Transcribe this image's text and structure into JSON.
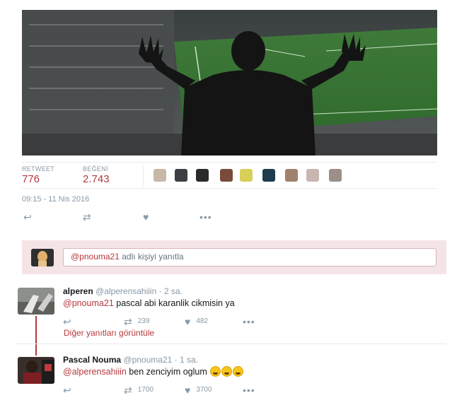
{
  "stats": {
    "retweet_label": "RETWEET",
    "retweet_count": "776",
    "like_label": "BEĞENİ",
    "like_count": "2.743"
  },
  "liker_avatars": [
    "#c9b8a8",
    "#3b3f44",
    "#2a2a2a",
    "#7a4b3b",
    "#d8cf5a",
    "#1f3c4c",
    "#a0826d",
    "#c7b7b0",
    "#9b8f87"
  ],
  "timestamp": "09:15 - 11 Nis 2016",
  "actions": {
    "reply_icon": "reply-icon",
    "retweet_icon": "retweet-icon",
    "like_icon": "heart-icon",
    "more_icon": "more-icon"
  },
  "reply": {
    "mention": "@pnouma21",
    "text": " adlı kişiyi yanıtla"
  },
  "tweets": [
    {
      "name": "alperen",
      "handle": "@alperensahiiin",
      "time": "· 2 sa.",
      "mention": "@pnouma21",
      "text": " pascal abi karanlik cikmisin ya",
      "retweets": "239",
      "likes": "482"
    },
    {
      "name": "Pascal Nouma",
      "handle": "@pnouma21",
      "time": "· 1 sa.",
      "mention": "@alperensahiiin",
      "text": " ben zenciyim oglum",
      "retweets": "1700",
      "likes": "3700"
    }
  ],
  "thread_link": "Diğer yanıtları görüntüle",
  "colors": {
    "accent": "#b5393d",
    "muted": "#8899a6",
    "reply_bg": "#f5e4e6"
  }
}
